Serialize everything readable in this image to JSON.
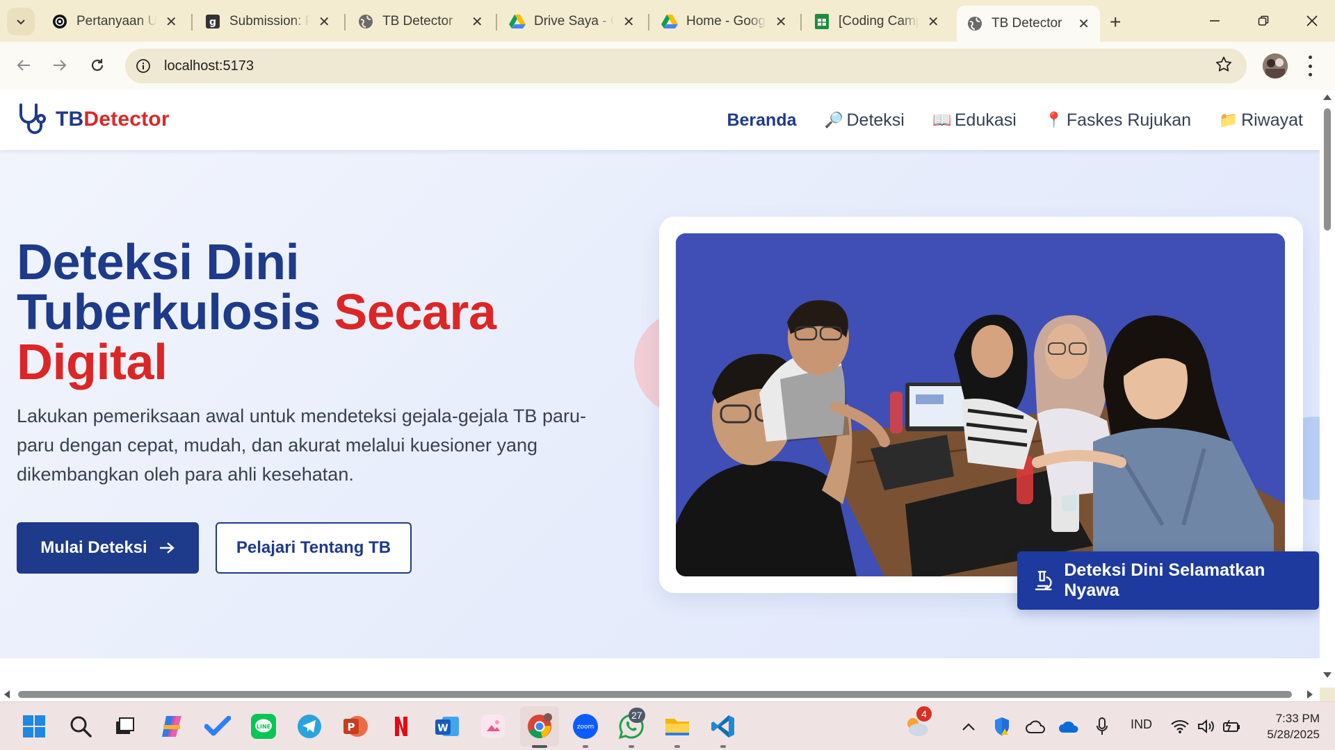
{
  "browser": {
    "tabs": [
      {
        "title": "Pertanyaan Ul",
        "icon": "openai-icon"
      },
      {
        "title": "Submission: P",
        "icon": "g-logo-icon"
      },
      {
        "title": "TB Detector",
        "icon": "globe-icon"
      },
      {
        "title": "Drive Saya - G",
        "icon": "google-drive-icon"
      },
      {
        "title": "Home - Googl",
        "icon": "google-drive-icon"
      },
      {
        "title": "[Coding Camp",
        "icon": "google-sheets-icon"
      },
      {
        "title": "TB Detector",
        "icon": "globe-icon",
        "active": true
      }
    ],
    "close_glyph": "✕",
    "new_tab_glyph": "+",
    "url": "localhost:5173"
  },
  "site": {
    "logo": {
      "part1": "TB",
      "part2": "Detector"
    },
    "nav": [
      {
        "label": "Beranda",
        "emoji": "",
        "active": true
      },
      {
        "label": "Deteksi",
        "emoji": "🔎"
      },
      {
        "label": "Edukasi",
        "emoji": "📖"
      },
      {
        "label": "Faskes Rujukan",
        "emoji": "📍"
      },
      {
        "label": "Riwayat",
        "emoji": "📁"
      }
    ],
    "hero": {
      "title_line1": "Deteksi Dini",
      "title_line2_a": "Tuberkulosis ",
      "title_line2_b": "Secara",
      "title_line3": "Digital",
      "description": "Lakukan pemeriksaan awal untuk mendeteksi gejala-gejala TB paru-paru dengan cepat, mudah, dan akurat melalui kuesioner yang dikembangkan oleh para ahli kesehatan.",
      "primary_button": "Mulai Deteksi",
      "secondary_button": "Pelajari Tentang TB",
      "badge": "Deteksi Dini Selamatkan Nyawa"
    },
    "colors": {
      "brand_blue": "#1e3a8a",
      "brand_red": "#dc2626",
      "photo_bg": "#3f4fb5"
    }
  },
  "taskbar": {
    "apps": [
      "windows-start-icon",
      "search-icon",
      "task-view-icon",
      "copilot-icon",
      "todo-icon",
      "line-icon",
      "telegram-icon",
      "powerpoint-icon",
      "netflix-icon",
      "word-icon",
      "photos-icon",
      "chrome-icon",
      "zoom-icon",
      "whatsapp-icon",
      "file-explorer-icon",
      "vscode-icon"
    ],
    "whatsapp_badge": "27",
    "weather_badge": "4",
    "language": "IND",
    "time": "7:33 PM",
    "date": "5/28/2025"
  }
}
